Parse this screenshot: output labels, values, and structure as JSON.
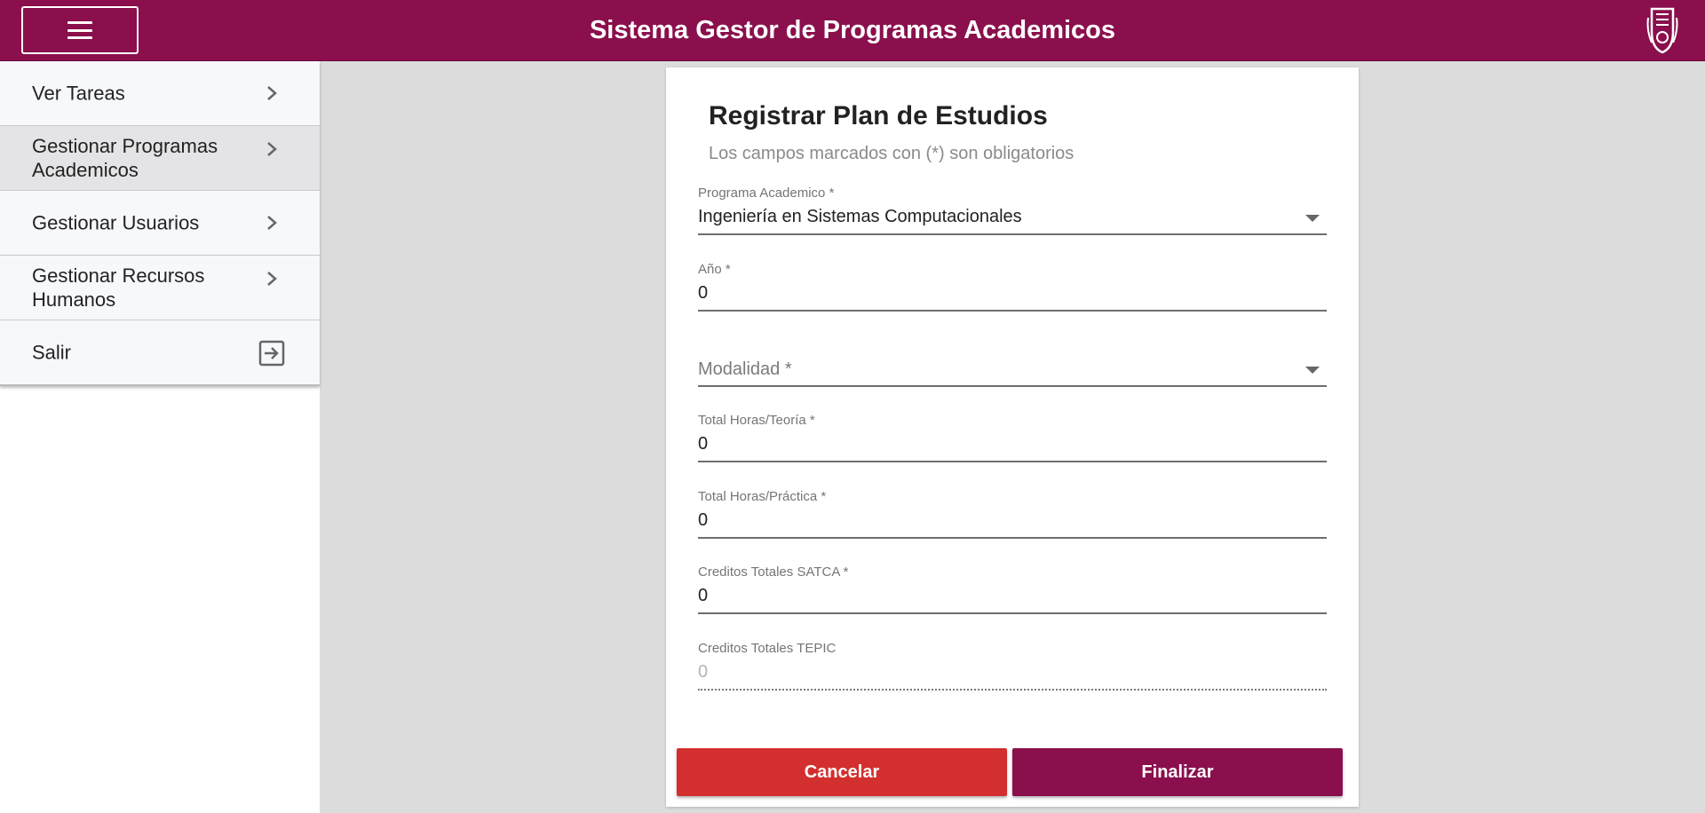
{
  "header": {
    "title": "Sistema Gestor de Programas Academicos",
    "menu_icon": "hamburger-icon",
    "logo": "ipn-logo",
    "brand_color": "#8a0f4c"
  },
  "sidebar": {
    "items": [
      {
        "label": "Ver Tareas",
        "icon": "chevron-right-icon"
      },
      {
        "label": "Gestionar Programas Academicos",
        "icon": "chevron-right-icon",
        "active": true
      },
      {
        "label": "Gestionar Usuarios",
        "icon": "chevron-right-icon"
      },
      {
        "label": "Gestionar Recursos Humanos",
        "icon": "chevron-right-icon"
      },
      {
        "label": "Salir",
        "icon": "exit-icon"
      }
    ]
  },
  "form": {
    "title": "Registrar Plan de Estudios",
    "subtitle": "Los campos marcados con (*) son obligatorios",
    "programa": {
      "label": "Programa Academico *",
      "value": "Ingeniería en Sistemas Computacionales"
    },
    "anio": {
      "label": "Año *",
      "value": "0"
    },
    "modalidad": {
      "placeholder": "Modalidad *",
      "value": ""
    },
    "horas_teoria": {
      "label": "Total Horas/Teoría *",
      "value": "0"
    },
    "horas_practica": {
      "label": "Total Horas/Práctica *",
      "value": "0"
    },
    "creditos_satca": {
      "label": "Creditos Totales SATCA *",
      "value": "0"
    },
    "creditos_tepic": {
      "label": "Creditos Totales TEPIC",
      "value": "0"
    },
    "cancel_label": "Cancelar",
    "finish_label": "Finalizar",
    "cancel_color": "#d32f2f",
    "finish_color": "#8a0f4c"
  }
}
